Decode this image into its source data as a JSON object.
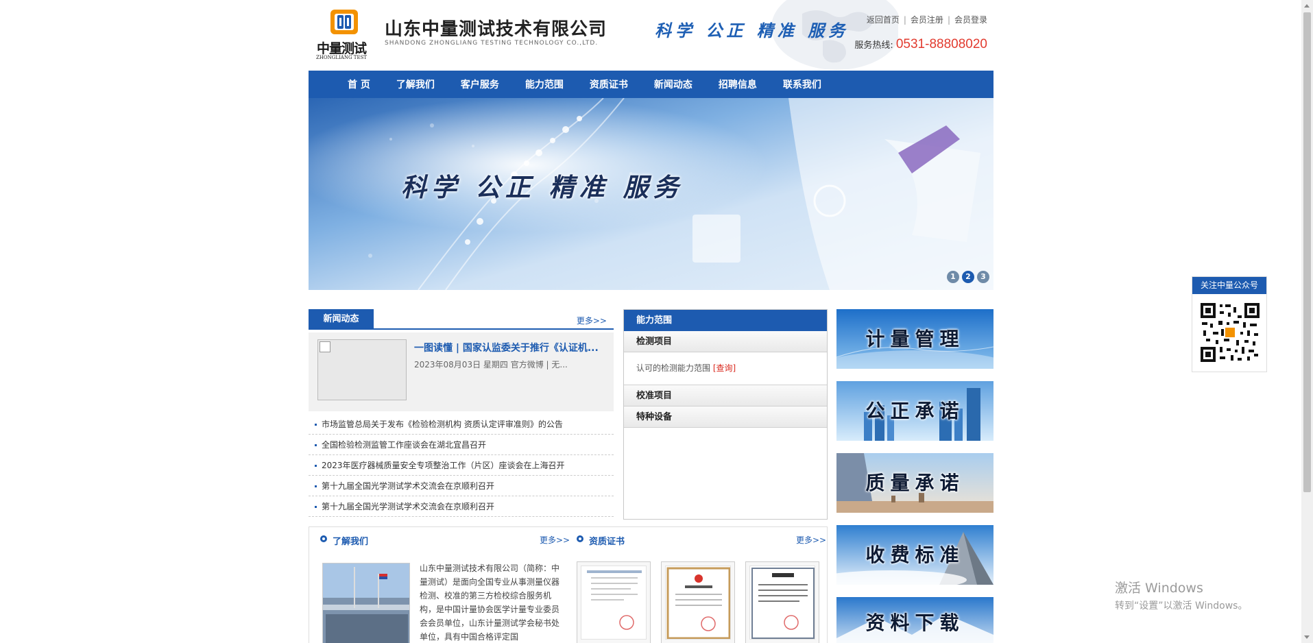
{
  "header": {
    "logo_cn": "中量测试",
    "logo_en": "ZHONGLIANG TEST",
    "company_cn": "山东中量测试技术有限公司",
    "company_en": "SHANDONG ZHONGLIANG TESTING TECHNOLOGY CO.,LTD.",
    "slogan": "科学 公正 精准 服务",
    "links": [
      "返回首页",
      "会员注册",
      "会员登录"
    ],
    "hotline_label": "服务热线:",
    "hotline_number": "0531-88808020"
  },
  "nav": [
    "首 页",
    "了解我们",
    "客户服务",
    "能力范围",
    "资质证书",
    "新闻动态",
    "招聘信息",
    "联系我们"
  ],
  "banner": {
    "text": "科学 公正 精准 服务",
    "dots": [
      "1",
      "2",
      "3"
    ],
    "active_dot": "2"
  },
  "news": {
    "title": "新闻动态",
    "more": "更多>>",
    "feature_title": "一图读懂 | 国家认监委关于推行《认证机...",
    "feature_meta": "2023年08月03日 星期四 官方微博 | 无...",
    "items": [
      "市场监管总局关于发布《检验检测机构 资质认定评审准则》的公告",
      "全国检验检测监管工作座谈会在湖北宜昌召开",
      "2023年医疗器械质量安全专项整治工作（片区）座谈会在上海召开",
      "第十九届全国光学测试学术交流会在京顺利召开",
      "第十九届全国光学测试学术交流会在京顺利召开"
    ]
  },
  "capability": {
    "title": "能力范围",
    "item1": "检测项目",
    "item1_text": "认可的检测能力范围",
    "item1_link": "[查询]",
    "item2": "校准项目",
    "item3": "特种设备"
  },
  "side_buttons": [
    "计量管理",
    "公正承诺",
    "质量承诺",
    "收费标准",
    "资料下载"
  ],
  "about": {
    "title": "了解我们",
    "more": "更多>>",
    "text": "山东中量测试技术有限公司（简称：中量测试）是面向全国专业从事测量仪器检测、校准的第三方检校综合服务机构，是中国计量协会医学计量专业委员会会员单位，山东计量测试学会秘书处单位，具有中国合格评定国"
  },
  "certs": {
    "title": "资质证书",
    "more": "更多>>"
  },
  "qr": {
    "title": "关注中量公众号"
  },
  "windows": {
    "title": "激活 Windows",
    "subtitle": "转到“设置”以激活 Windows。"
  },
  "colors": {
    "brand": "#1d5bb0",
    "hotline": "#e23a2e",
    "link_red": "#d9281d"
  }
}
